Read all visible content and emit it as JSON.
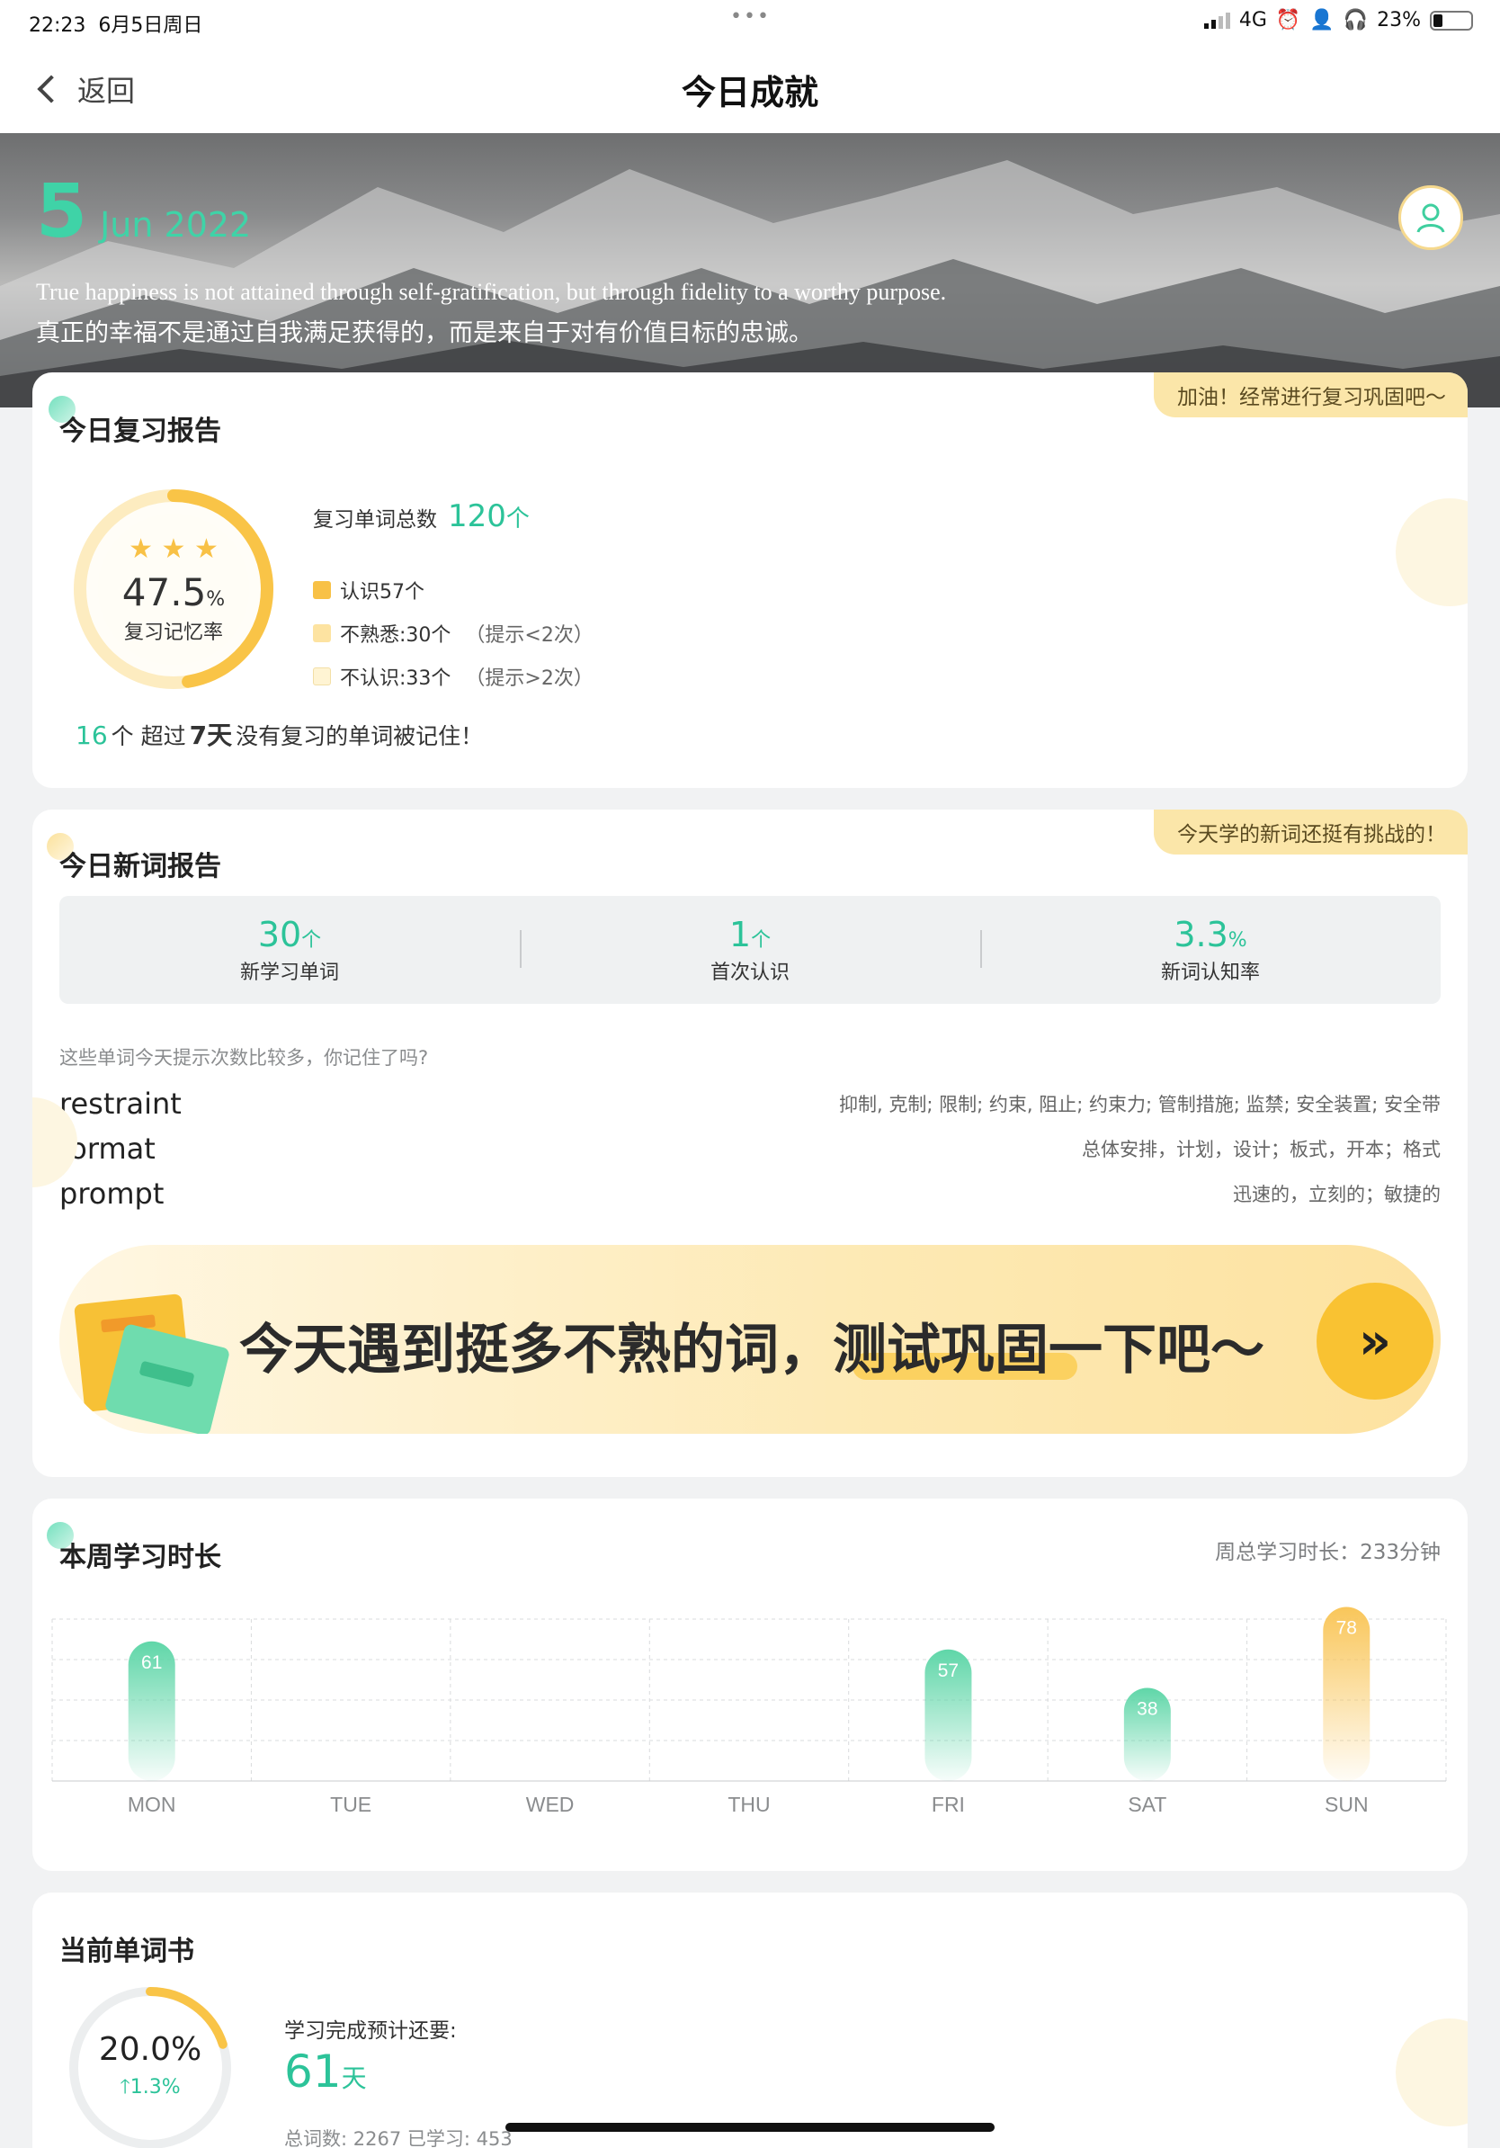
{
  "status_bar": {
    "time": "22:23",
    "date": "6月5日周日",
    "network": "4G",
    "battery": "23%"
  },
  "nav": {
    "back_label": "返回",
    "title": "今日成就"
  },
  "hero": {
    "day": "5",
    "month_year": "Jun 2022",
    "quote_en": "True happiness is not attained through self-gratification, but through fidelity to a worthy purpose.",
    "quote_zh": "真正的幸福不是通过自我满足获得的，而是来自于对有价值目标的忠诚。"
  },
  "review": {
    "title": "今日复习报告",
    "ribbon": "加油！经常进行复习巩固吧～",
    "stars": "★ ★ ★",
    "rate_value": "47.5",
    "rate_unit": "%",
    "rate_label": "复习记忆率",
    "rate_fraction": 0.475,
    "total_label": "复习单词总数",
    "total_value": "120",
    "total_unit": "个",
    "legend": [
      {
        "text": "认识57个",
        "hint": "",
        "color": "#f8c146"
      },
      {
        "text": "不熟悉:30个",
        "hint": "（提示<2次）",
        "color": "#fde3a1"
      },
      {
        "text": "不认识:33个",
        "hint": "（提示>2次）",
        "color": "#fff4d3"
      }
    ],
    "note_count": "16",
    "note_mid": "个 超过 ",
    "note_days": "7天",
    "note_tail": " 没有复习的单词被记住！"
  },
  "new_words": {
    "title": "今日新词报告",
    "ribbon": "今天学的新词还挺有挑战的！",
    "stats": [
      {
        "value": "30",
        "unit": "个",
        "label": "新学习单词"
      },
      {
        "value": "1",
        "unit": "个",
        "label": "首次认识"
      },
      {
        "value": "3.3",
        "unit": "%",
        "label": "新词认知率"
      }
    ],
    "hint": "这些单词今天提示次数比较多，你记住了吗?",
    "words": [
      {
        "word": "restraint",
        "meaning": "抑制, 克制; 限制; 约束, 阻止; 约束力; 管制措施; 监禁; 安全装置; 安全带"
      },
      {
        "word": "format",
        "meaning": "总体安排，计划，设计；板式，开本；格式"
      },
      {
        "word": "prompt",
        "meaning": "迅速的，立刻的；敏捷的"
      }
    ],
    "banner_text": "今天遇到挺多不熟的词，测试巩固一下吧～",
    "banner_button": "»"
  },
  "weekly": {
    "title": "本周学习时长",
    "total_label": "周总学习时长：233分钟",
    "chart_data": {
      "type": "bar",
      "categories": [
        "MON",
        "TUE",
        "WED",
        "THU",
        "FRI",
        "SAT",
        "SUN"
      ],
      "values": [
        61,
        0,
        0,
        0,
        57,
        38,
        78
      ],
      "ylim": [
        0,
        80
      ],
      "grid": true,
      "highlight_color": "#f9c65a",
      "bar_color": "#5fd6a8"
    }
  },
  "book": {
    "title": "当前单词书",
    "progress_value": "20.0%",
    "progress_fraction": 0.2,
    "delta": "1.3%",
    "est_label": "学习完成预计还要:",
    "days_value": "61",
    "days_unit": "天",
    "footer": "总词数: 2267  已学习: 453"
  }
}
